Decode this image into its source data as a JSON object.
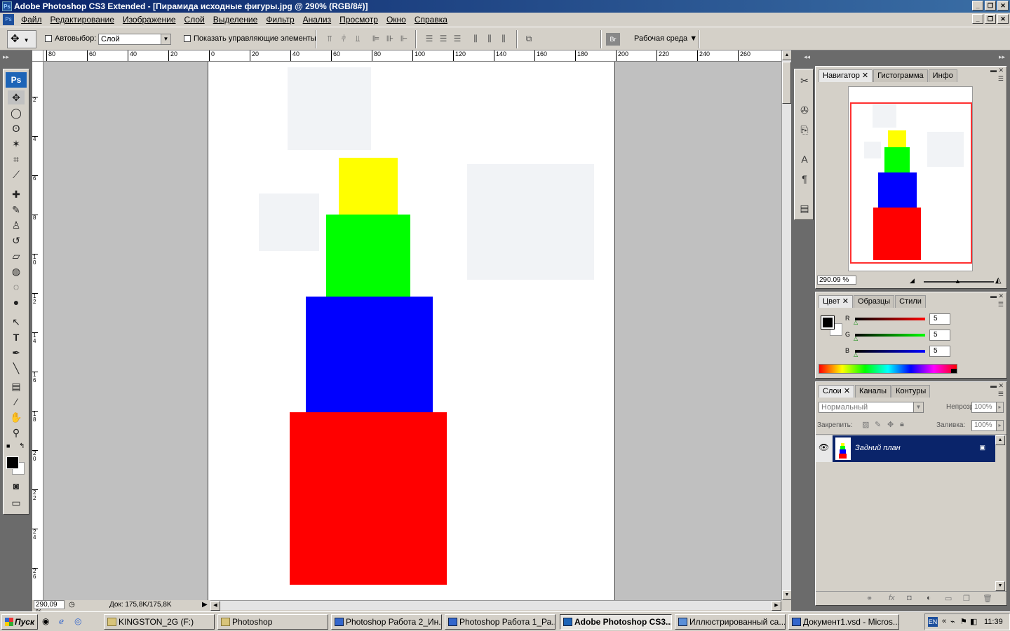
{
  "window": {
    "title": "Adobe Photoshop CS3 Extended - [Пирамида исходные фигуры.jpg @ 290% (RGB/8#)]",
    "app_icon": "Ps"
  },
  "menu": [
    "Файл",
    "Редактирование",
    "Изображение",
    "Слой",
    "Выделение",
    "Фильтр",
    "Анализ",
    "Просмотр",
    "Окно",
    "Справка"
  ],
  "options": {
    "autoselect_label": "Автовыбор:",
    "autoselect_value": "Слой",
    "show_controls_label": "Показать управляющие элементы",
    "workspace_label": "Рабочая среда",
    "bridge_icon": "Br"
  },
  "ruler_h": [
    "80",
    "60",
    "40",
    "20",
    "0",
    "20",
    "40",
    "60",
    "80",
    "100",
    "120",
    "140",
    "160",
    "180",
    "200",
    "220",
    "240",
    "260"
  ],
  "ruler_v": [
    "2",
    "4",
    "6",
    "8",
    "10",
    "12",
    "14",
    "16",
    "18",
    "20",
    "22",
    "24",
    "26",
    "28"
  ],
  "toolbox": {
    "logo": "Ps"
  },
  "canvas": {
    "blocks": [
      {
        "name": "yellow-block",
        "color": "#ffff00"
      },
      {
        "name": "green-block",
        "color": "#00ff00"
      },
      {
        "name": "blue-block",
        "color": "#0000ff"
      },
      {
        "name": "red-block",
        "color": "#ff0000"
      }
    ]
  },
  "status": {
    "zoom": "290,09 %",
    "doc": "Док: 175,8K/175,8K"
  },
  "navigator": {
    "tabs": [
      "Навигатор",
      "Гистограмма",
      "Инфо"
    ],
    "zoom": "290.09 %"
  },
  "color_panel": {
    "tabs": [
      "Цвет",
      "Образцы",
      "Стили"
    ],
    "channels": [
      {
        "label": "R",
        "value": "5"
      },
      {
        "label": "G",
        "value": "5"
      },
      {
        "label": "B",
        "value": "5"
      }
    ]
  },
  "layers_panel": {
    "tabs": [
      "Слои",
      "Каналы",
      "Контуры"
    ],
    "blend_mode": "Нормальный",
    "opacity_label": "Непрозр.:",
    "opacity_value": "100%",
    "lock_label": "Закрепить:",
    "fill_label": "Заливка:",
    "fill_value": "100%",
    "layers": [
      {
        "name": "Задний план"
      }
    ]
  },
  "taskbar": {
    "start": "Пуск",
    "items": [
      {
        "label": "KINGSTON_2G (F:)",
        "active": false
      },
      {
        "label": "Photoshop",
        "active": false
      },
      {
        "label": "Photoshop Работа 2_Ин...",
        "active": false
      },
      {
        "label": "Photoshop Работа 1_Ра...",
        "active": false
      },
      {
        "label": "Adobe Photoshop CS3...",
        "active": true
      },
      {
        "label": "Иллюстрированный са...",
        "active": false
      },
      {
        "label": "Документ1.vsd - Micros...",
        "active": false
      }
    ],
    "lang": "EN",
    "time": "11:39"
  }
}
